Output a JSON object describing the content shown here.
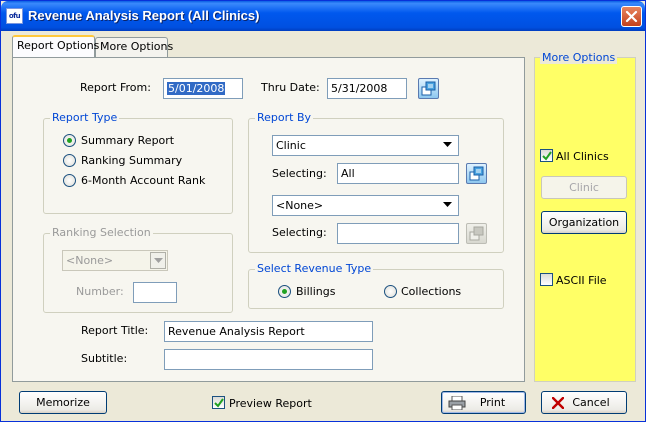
{
  "window": {
    "title": "Revenue Analysis Report (All Clinics)",
    "app_icon_text": "ofu"
  },
  "tabs": [
    {
      "label": "Report Options",
      "active": true
    },
    {
      "label": "More Options",
      "active": false
    }
  ],
  "dates": {
    "from_label": "Report From:",
    "from_value": "5/01/2008",
    "thru_label": "Thru Date:",
    "thru_value": "5/31/2008"
  },
  "report_type": {
    "label": "Report Type",
    "options": [
      "Summary Report",
      "Ranking Summary",
      "6-Month Account Rank"
    ],
    "selected": "Summary Report"
  },
  "report_by": {
    "label": "Report By",
    "combo1_value": "Clinic",
    "selecting_label": "Selecting:",
    "selecting1_value": "All",
    "combo2_value": "<None>",
    "selecting2_value": ""
  },
  "ranking_selection": {
    "label": "Ranking Selection",
    "combo_value": "<None>",
    "number_label": "Number:",
    "number_value": ""
  },
  "revenue_type": {
    "label": "Select Revenue Type",
    "options": [
      "Billings",
      "Collections"
    ],
    "selected": "Billings"
  },
  "titles": {
    "report_title_label": "Report Title:",
    "report_title_value": "Revenue Analysis Report",
    "subtitle_label": "Subtitle:",
    "subtitle_value": ""
  },
  "more_options": {
    "label": "More Options",
    "all_clinics_label": "All Clinics",
    "all_clinics_checked": true,
    "clinic_button": "Clinic",
    "organization_button": "Organization",
    "ascii_label": "ASCII File",
    "ascii_checked": false
  },
  "footer": {
    "memorize_button": "Memorize",
    "preview_label": "Preview Report",
    "preview_checked": true,
    "print_button": "Print",
    "cancel_button": "Cancel"
  },
  "colors": {
    "titlebar": "#0058ee",
    "group_label": "#0046d5",
    "more_options_panel": "#ffff66",
    "radio_dot": "#21a121",
    "check_mark": "#21a121",
    "cancel_x": "#c00000"
  }
}
